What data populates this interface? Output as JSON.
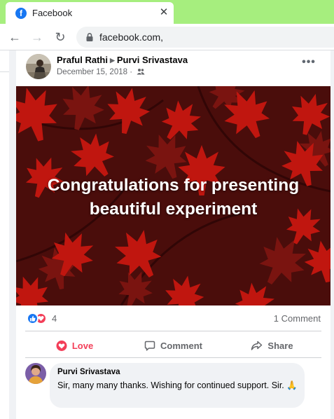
{
  "browser": {
    "tab_title": "Facebook",
    "favicon_letter": "f",
    "close_glyph": "✕",
    "url": "facebook.com,",
    "back_glyph": "←",
    "forward_glyph": "→",
    "reload_glyph": "↻"
  },
  "post": {
    "author": "Praful Rathi",
    "recipient": "Purvi Srivastava",
    "date": "December 15, 2018 ·",
    "privacy_icon": "friends-icon",
    "more_glyph": "•••",
    "banner_text_line1": "Congratulations for presenting",
    "banner_text_line2": "beautiful experiment",
    "banner_colors": {
      "background": "#4a0d0b",
      "leaf_bright": "#c0160f",
      "leaf_dark": "#7a1410"
    },
    "reaction_count": "4",
    "comment_count": "1 Comment",
    "reactions": [
      "like-icon",
      "love-icon"
    ]
  },
  "actions": {
    "love": "Love",
    "comment": "Comment",
    "share": "Share"
  },
  "comment": {
    "author": "Purvi Srivastava",
    "text": "Sir, many many thanks. Wishing for continued support. Sir. 🙏"
  },
  "colors": {
    "chrome_tabbar": "#a6ee7e",
    "fb_blue": "#1877f2",
    "love_red": "#f33e58",
    "muted_text": "#65676b"
  }
}
